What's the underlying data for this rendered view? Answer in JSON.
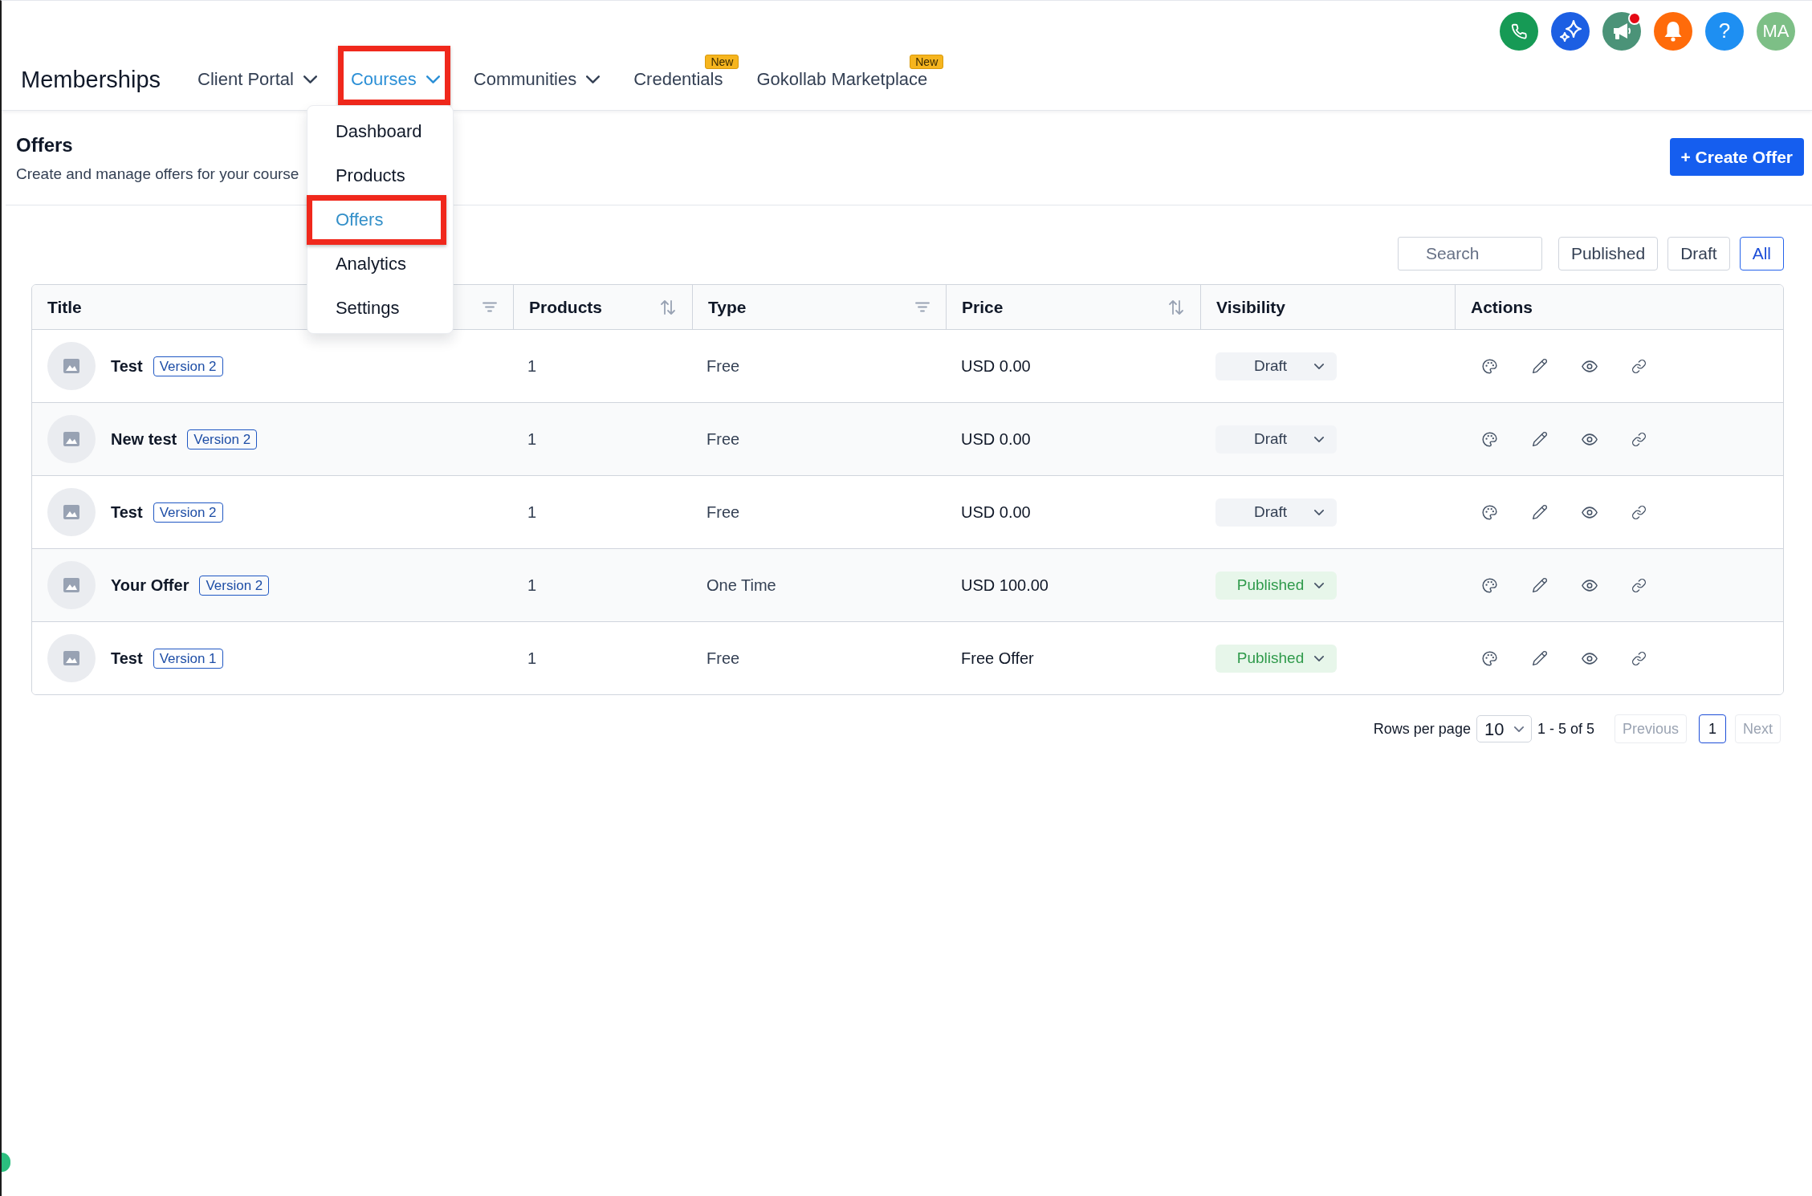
{
  "header": {
    "title": "Memberships",
    "nav": [
      {
        "label": "Client Portal",
        "dropdown": true,
        "selected": false,
        "highlighted": false
      },
      {
        "label": "Courses",
        "dropdown": true,
        "selected": true,
        "highlighted": true,
        "menu": {
          "items": [
            {
              "label": "Dashboard",
              "selected": false,
              "highlighted": false
            },
            {
              "label": "Products",
              "selected": false,
              "highlighted": false
            },
            {
              "label": "Offers",
              "selected": true,
              "highlighted": true
            },
            {
              "label": "Analytics",
              "selected": false,
              "highlighted": false
            },
            {
              "label": "Settings",
              "selected": false,
              "highlighted": false
            }
          ]
        }
      },
      {
        "label": "Communities",
        "dropdown": true,
        "selected": false,
        "highlighted": false
      },
      {
        "label": "Credentials",
        "dropdown": false,
        "selected": false,
        "highlighted": false,
        "badge": "New"
      },
      {
        "label": "Gokollab Marketplace",
        "dropdown": false,
        "selected": false,
        "highlighted": false,
        "badge": "New"
      }
    ],
    "toolbar": [
      {
        "kind": "phone",
        "notification": false
      },
      {
        "kind": "sparkle",
        "notification": false
      },
      {
        "kind": "megaphone",
        "notification": true
      },
      {
        "kind": "bell",
        "notification": false
      },
      {
        "kind": "help",
        "label": "?",
        "notification": false
      }
    ],
    "avatar": {
      "initials": "MA"
    }
  },
  "page": {
    "title": "Offers",
    "subtitle": "Create and manage offers for your course",
    "create_button": "+ Create Offer"
  },
  "filters": {
    "search": {
      "placeholder": "Search"
    },
    "options": [
      {
        "label": "Published",
        "selected": false
      },
      {
        "label": "Draft",
        "selected": false
      },
      {
        "label": "All",
        "selected": true
      }
    ]
  },
  "table": {
    "columns": [
      {
        "label": "Title",
        "kind": "filter"
      },
      {
        "label": "Products",
        "kind": "sort"
      },
      {
        "label": "Type",
        "kind": "filter"
      },
      {
        "label": "Price",
        "kind": "sort"
      },
      {
        "label": "Visibility",
        "kind": "plain"
      },
      {
        "label": "Actions",
        "kind": "plain"
      }
    ],
    "rows": [
      {
        "title": "Test",
        "version": "Version 2",
        "products": "1",
        "type": "Free",
        "price": "USD 0.00",
        "visibility": {
          "label": "Draft",
          "published": false
        }
      },
      {
        "title": "New test",
        "version": "Version 2",
        "products": "1",
        "type": "Free",
        "price": "USD 0.00",
        "visibility": {
          "label": "Draft",
          "published": false
        }
      },
      {
        "title": "Test",
        "version": "Version 2",
        "products": "1",
        "type": "Free",
        "price": "USD 0.00",
        "visibility": {
          "label": "Draft",
          "published": false
        }
      },
      {
        "title": "Your Offer",
        "version": "Version 2",
        "products": "1",
        "type": "One Time",
        "price": "USD 100.00",
        "visibility": {
          "label": "Published",
          "published": true
        }
      },
      {
        "title": "Test",
        "version": "Version 1",
        "products": "1",
        "type": "Free",
        "price": "Free Offer",
        "visibility": {
          "label": "Published",
          "published": true
        }
      }
    ]
  },
  "pagination": {
    "rows_per_page_label": "Rows per page",
    "page_size": "10",
    "range": "1 - 5 of 5",
    "previous": {
      "label": "Previous",
      "disabled": true
    },
    "pages": [
      {
        "label": "1",
        "selected": true
      }
    ],
    "next": {
      "label": "Next",
      "disabled": true
    }
  }
}
